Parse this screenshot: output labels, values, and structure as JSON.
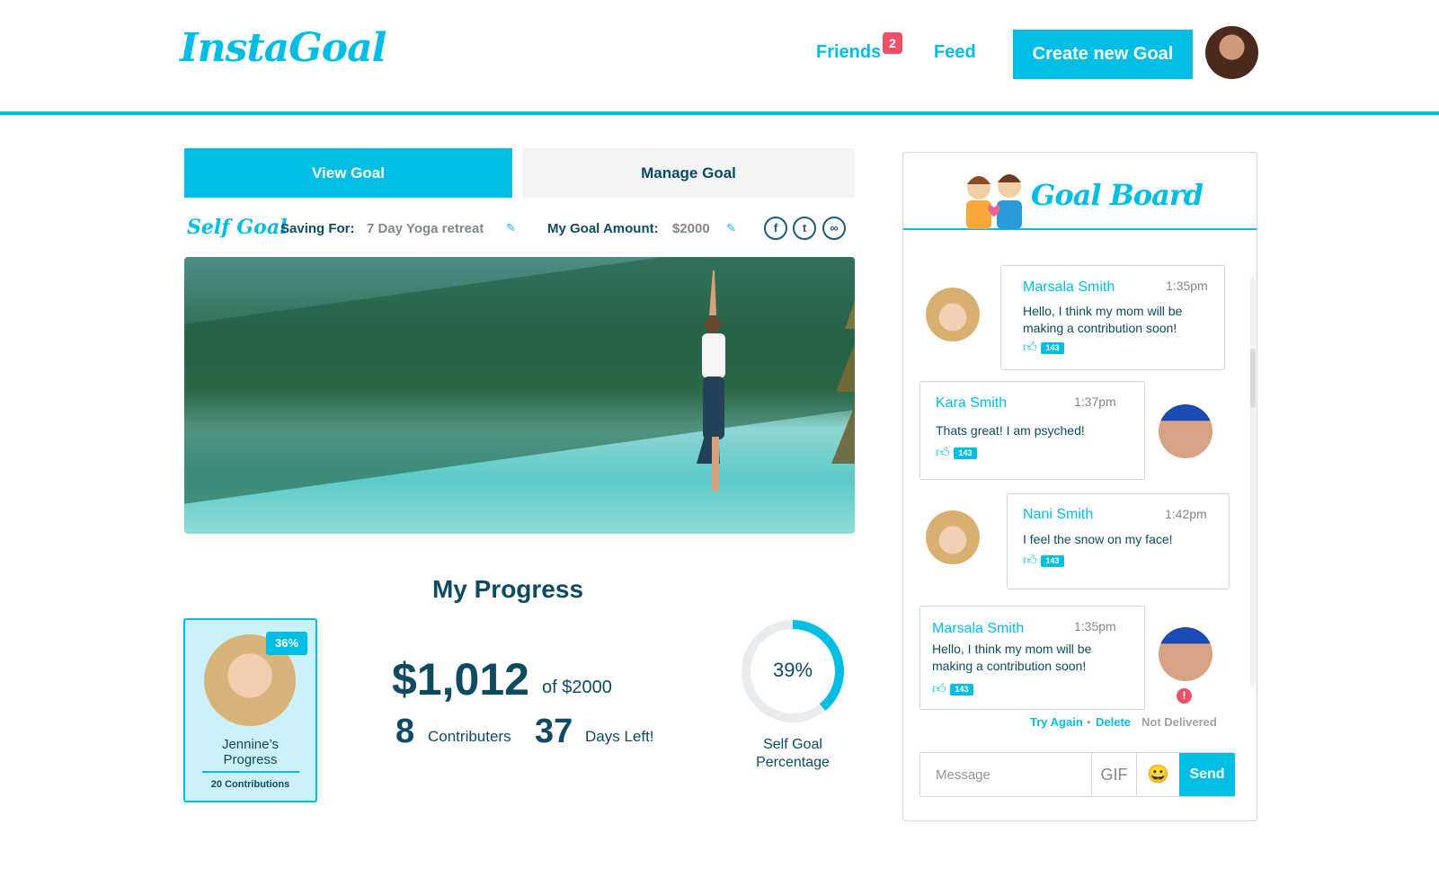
{
  "header": {
    "logo": "InstaGoal",
    "nav": {
      "friends": "Friends",
      "friends_badge": "2",
      "feed": "Feed"
    },
    "create_button": "Create new Goal"
  },
  "tabs": {
    "view": "View Goal",
    "manage": "Manage Goal"
  },
  "goal": {
    "type_label": "Self Goal",
    "saving_for_label": "Saving For:",
    "saving_for_value": "7 Day Yoga retreat",
    "amount_label": "My Goal Amount:",
    "amount_value": "$2000"
  },
  "social": {
    "facebook": "f",
    "twitter": "t",
    "link": "∞"
  },
  "progress": {
    "title": "My Progress",
    "card": {
      "percent": "36%",
      "name_line1": "Jennine’s",
      "name_line2": "Progress",
      "contributions": "20 Contributions"
    },
    "amount": "$1,012",
    "of_total": "of $2000",
    "contributors_count": "8",
    "contributors_label": "Contributers",
    "days_count": "37",
    "days_label": "Days Left!",
    "ring_percent_text": "39%",
    "ring_fraction": 0.39,
    "ring_label_line1": "Self Goal",
    "ring_label_line2": "Percentage"
  },
  "board": {
    "title": "Goal Board",
    "messages": [
      {
        "name": "Marsala Smith",
        "time": "1:35pm",
        "text_line1": "Hello, I think my mom will be",
        "text_line2": "making a contribution soon!",
        "likes": "143"
      },
      {
        "name": "Kara Smith",
        "time": "1:37pm",
        "text_line1": "Thats great! I am psyched!",
        "likes": "143"
      },
      {
        "name": "Nani Smith",
        "time": "1:42pm",
        "text_line1": "I feel the snow on my face!",
        "likes": "143"
      },
      {
        "name": "Marsala Smith",
        "time": "1:35pm",
        "text_line1": "Hello, I think my mom will be",
        "text_line2": "making a contribution soon!",
        "likes": "143"
      }
    ],
    "error": {
      "icon": "!",
      "try_again": "Try Again",
      "separator": "•",
      "delete": "Delete",
      "status": "Not Delivered"
    },
    "composer": {
      "placeholder": "Message",
      "gif": "GIF",
      "emoji": "😀",
      "send": "Send"
    }
  },
  "colors": {
    "accent": "#00bee3",
    "text": "#0d4b60",
    "badge": "#ef4f67",
    "muted": "#7d8a90"
  }
}
